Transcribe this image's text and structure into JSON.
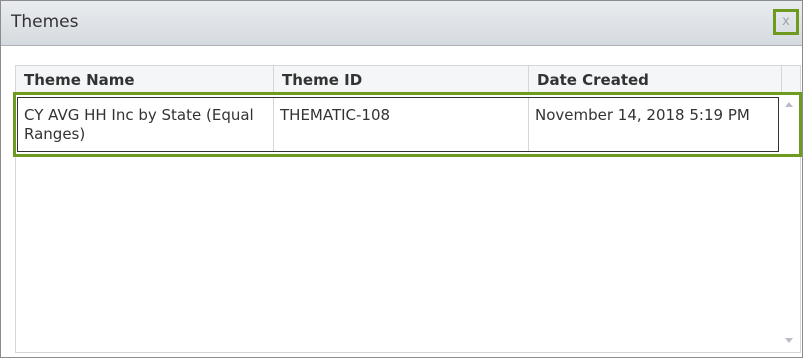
{
  "dialog": {
    "title": "Themes",
    "close_label": "x"
  },
  "grid": {
    "columns": [
      "Theme Name",
      "Theme ID",
      "Date Created",
      ""
    ],
    "rows": [
      {
        "theme_name": "CY AVG HH Inc by State (Equal Ranges)",
        "theme_id": "THEMATIC-108",
        "date_created": "November 14, 2018 5:19 PM"
      }
    ]
  },
  "icons": {
    "scroll_up": "scroll-up-arrow-icon",
    "scroll_down": "scroll-down-arrow-icon"
  },
  "colors": {
    "highlight": "#6e9a1f",
    "titlebar": "#dfe3e7",
    "text": "#333333"
  }
}
